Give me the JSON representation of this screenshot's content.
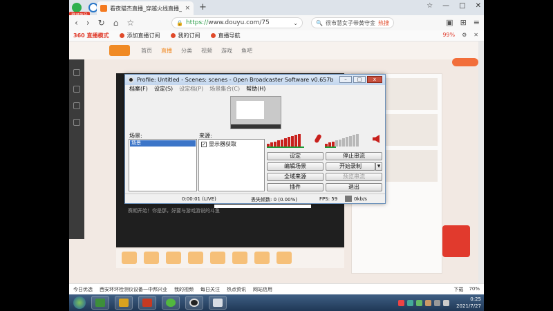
{
  "browser": {
    "login_badge": "登录账号",
    "tab_title": "看夜猫杰直播_穿越火线直播_斗鱼直播",
    "tab_close": "×",
    "new_tab": "+",
    "window_buttons": [
      "☆",
      "—",
      "□",
      "✕"
    ],
    "url_https": "https://",
    "url_rest": "www.douyu.com/75",
    "search_text": "很市慧女子带黄守金",
    "search_hot": "热搜",
    "nav_icons": [
      "back-icon",
      "forward-icon",
      "reload-icon",
      "home-icon",
      "star-icon"
    ],
    "right_icons": [
      "extension-icon",
      "grid-icon",
      "menu-icon"
    ]
  },
  "bookmarks": {
    "brand": "360 直播模式",
    "items": [
      "添加直播订阅",
      "我的订阅",
      "直播导航"
    ],
    "zoom": "99%"
  },
  "site": {
    "nav": [
      "首页",
      "直播",
      "分类",
      "视频",
      "游戏",
      "鱼吧"
    ],
    "player_caption": "赛期开始！你是那，好要与游戏游说的斗鱼"
  },
  "obs": {
    "title": "Profile: Untitled - Scenes: scenes - Open Broadcaster Software v0.657b",
    "menu": [
      "档案(F)",
      "设定(S)",
      "设定档(P)",
      "场景集合(C)",
      "帮助(H)"
    ],
    "scenes_label": "场景:",
    "scenes": [
      "场景"
    ],
    "sources_label": "来源:",
    "sources": [
      "显示器获取"
    ],
    "buttons": {
      "settings": "设定",
      "stop_stream": "停止串流",
      "edit_scene": "编辑场景",
      "start_record": "开始录制",
      "global_sources": "全域来源",
      "preview_stream": "预览串流",
      "plugins": "插件",
      "exit": "退出"
    },
    "status": {
      "time": "0:00:01 (LIVE)",
      "dropped": "丢失帧数: 0 (0.00%)",
      "fps": "FPS: 59",
      "bitrate": "0kb/s"
    },
    "mic_meter_levels": [
      0.2,
      0.28,
      0.36,
      0.44,
      0.52,
      0.6,
      0.68,
      0.76,
      0.84,
      0.92
    ],
    "desktop_meter_levels": [
      0.2,
      0.28,
      0.36,
      0.44,
      0.52,
      0.6,
      0.68,
      0.76,
      0.84,
      0.92
    ],
    "mic_meter_active": 10,
    "desktop_meter_active": 3
  },
  "infobar": {
    "items": [
      "今日优选",
      "西安环环检测仪设备一中邦兴业",
      "我的视频",
      "每日关注",
      "热点资讯",
      "网站信用"
    ],
    "right": [
      "下载",
      "70%"
    ]
  },
  "taskbar": {
    "time": "0:25",
    "date": "2021/7/27"
  }
}
